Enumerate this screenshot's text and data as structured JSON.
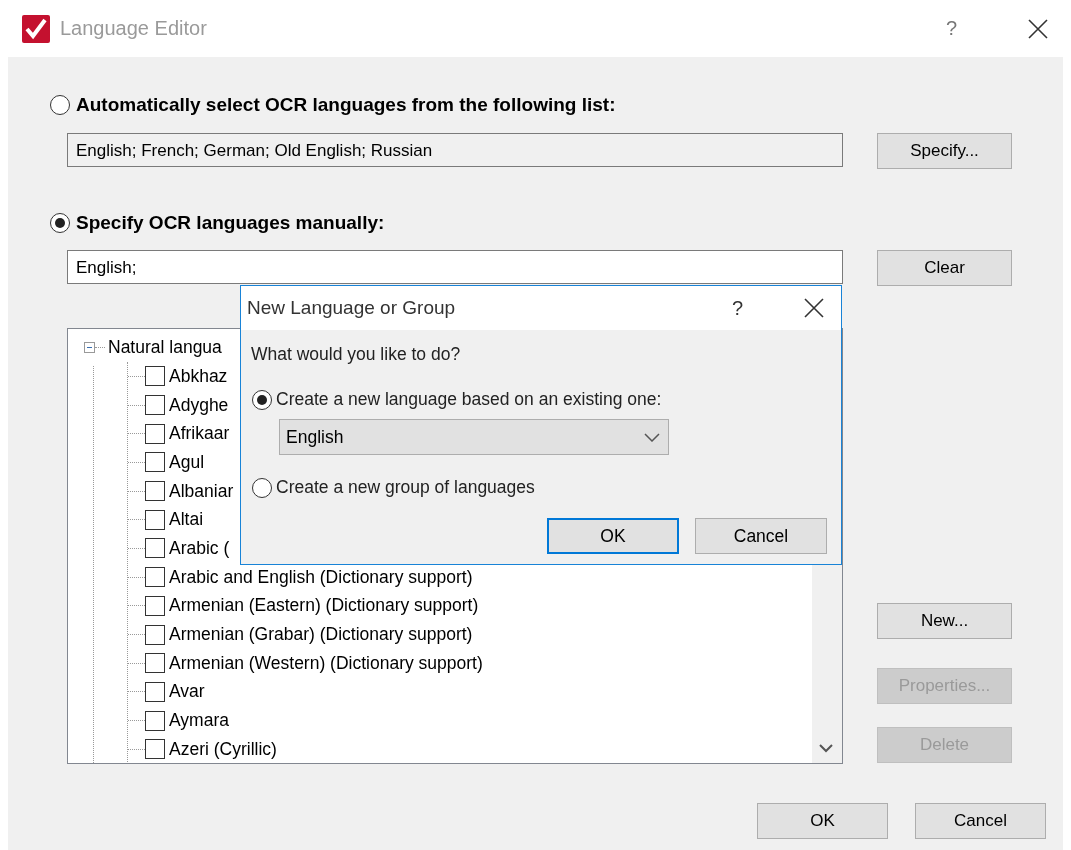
{
  "window": {
    "title": "Language Editor",
    "help": "?"
  },
  "auto_option": {
    "label": "Automatically select OCR languages from the following list:",
    "selected": false,
    "value": "English; French; German; Old English; Russian",
    "button": "Specify..."
  },
  "manual_option": {
    "label": "Specify OCR languages manually:",
    "selected": true,
    "value": "English;",
    "button": "Clear"
  },
  "tree": {
    "items": [
      {
        "label": "Natural langua",
        "expanded": true,
        "children": [
          {
            "label": "Abkhaz",
            "checked": false
          },
          {
            "label": "Adyghe",
            "checked": false
          },
          {
            "label": "Afrikaar",
            "checked": false
          },
          {
            "label": "Agul",
            "checked": false
          },
          {
            "label": "Albaniar",
            "checked": false
          },
          {
            "label": "Altai",
            "checked": false
          },
          {
            "label": "Arabic (",
            "checked": false
          },
          {
            "label": "Arabic and English (Dictionary support)",
            "checked": false
          },
          {
            "label": "Armenian (Eastern) (Dictionary support)",
            "checked": false
          },
          {
            "label": "Armenian (Grabar) (Dictionary support)",
            "checked": false
          },
          {
            "label": "Armenian (Western) (Dictionary support)",
            "checked": false
          },
          {
            "label": "Avar",
            "checked": false
          },
          {
            "label": "Aymara",
            "checked": false
          },
          {
            "label": "Azeri (Cyrillic)",
            "checked": false
          }
        ]
      }
    ]
  },
  "side_buttons": [
    {
      "label": "New...",
      "disabled": false
    },
    {
      "label": "Properties...",
      "disabled": true
    },
    {
      "label": "Delete",
      "disabled": true
    }
  ],
  "buttons": [
    {
      "label": "OK"
    },
    {
      "label": "Cancel"
    }
  ],
  "dialog": {
    "title": "New Language or Group",
    "help": "?",
    "question": "What would you like to do?",
    "options": [
      {
        "label": "Create a new language based on an existing one:",
        "selected": true
      },
      {
        "label": "Create a new group of languages",
        "selected": false
      }
    ],
    "dropdown": {
      "value": "English"
    },
    "buttons": [
      {
        "label": "OK",
        "default": true
      },
      {
        "label": "Cancel",
        "default": false
      }
    ]
  }
}
